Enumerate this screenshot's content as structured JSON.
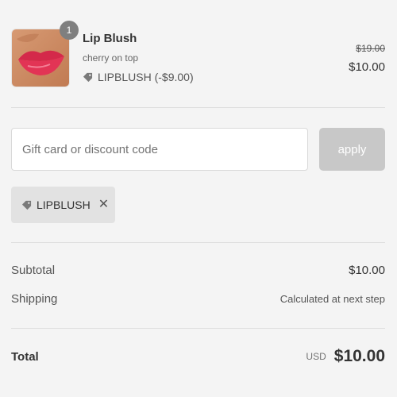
{
  "line_item": {
    "quantity": "1",
    "name": "Lip Blush",
    "variant": "cherry on top",
    "discount": "LIPBLUSH (-$9.00)",
    "original_price": "$19.00",
    "final_price": "$10.00",
    "image_icon": "lips-product-photo"
  },
  "discount_form": {
    "placeholder": "Gift card or discount code",
    "value": "",
    "apply_label": "apply"
  },
  "applied_code": {
    "code": "LIPBLUSH",
    "remove_glyph": "✕"
  },
  "summary": {
    "subtotal_label": "Subtotal",
    "subtotal_value": "$10.00",
    "shipping_label": "Shipping",
    "shipping_value": "Calculated at next step",
    "total_label": "Total",
    "currency": "USD",
    "total_value": "$10.00"
  },
  "colors": {
    "background": "#f4f4f4",
    "apply_disabled": "#c8c8c8",
    "chip": "#e2e2e2",
    "badge": "#7f7f7f"
  }
}
